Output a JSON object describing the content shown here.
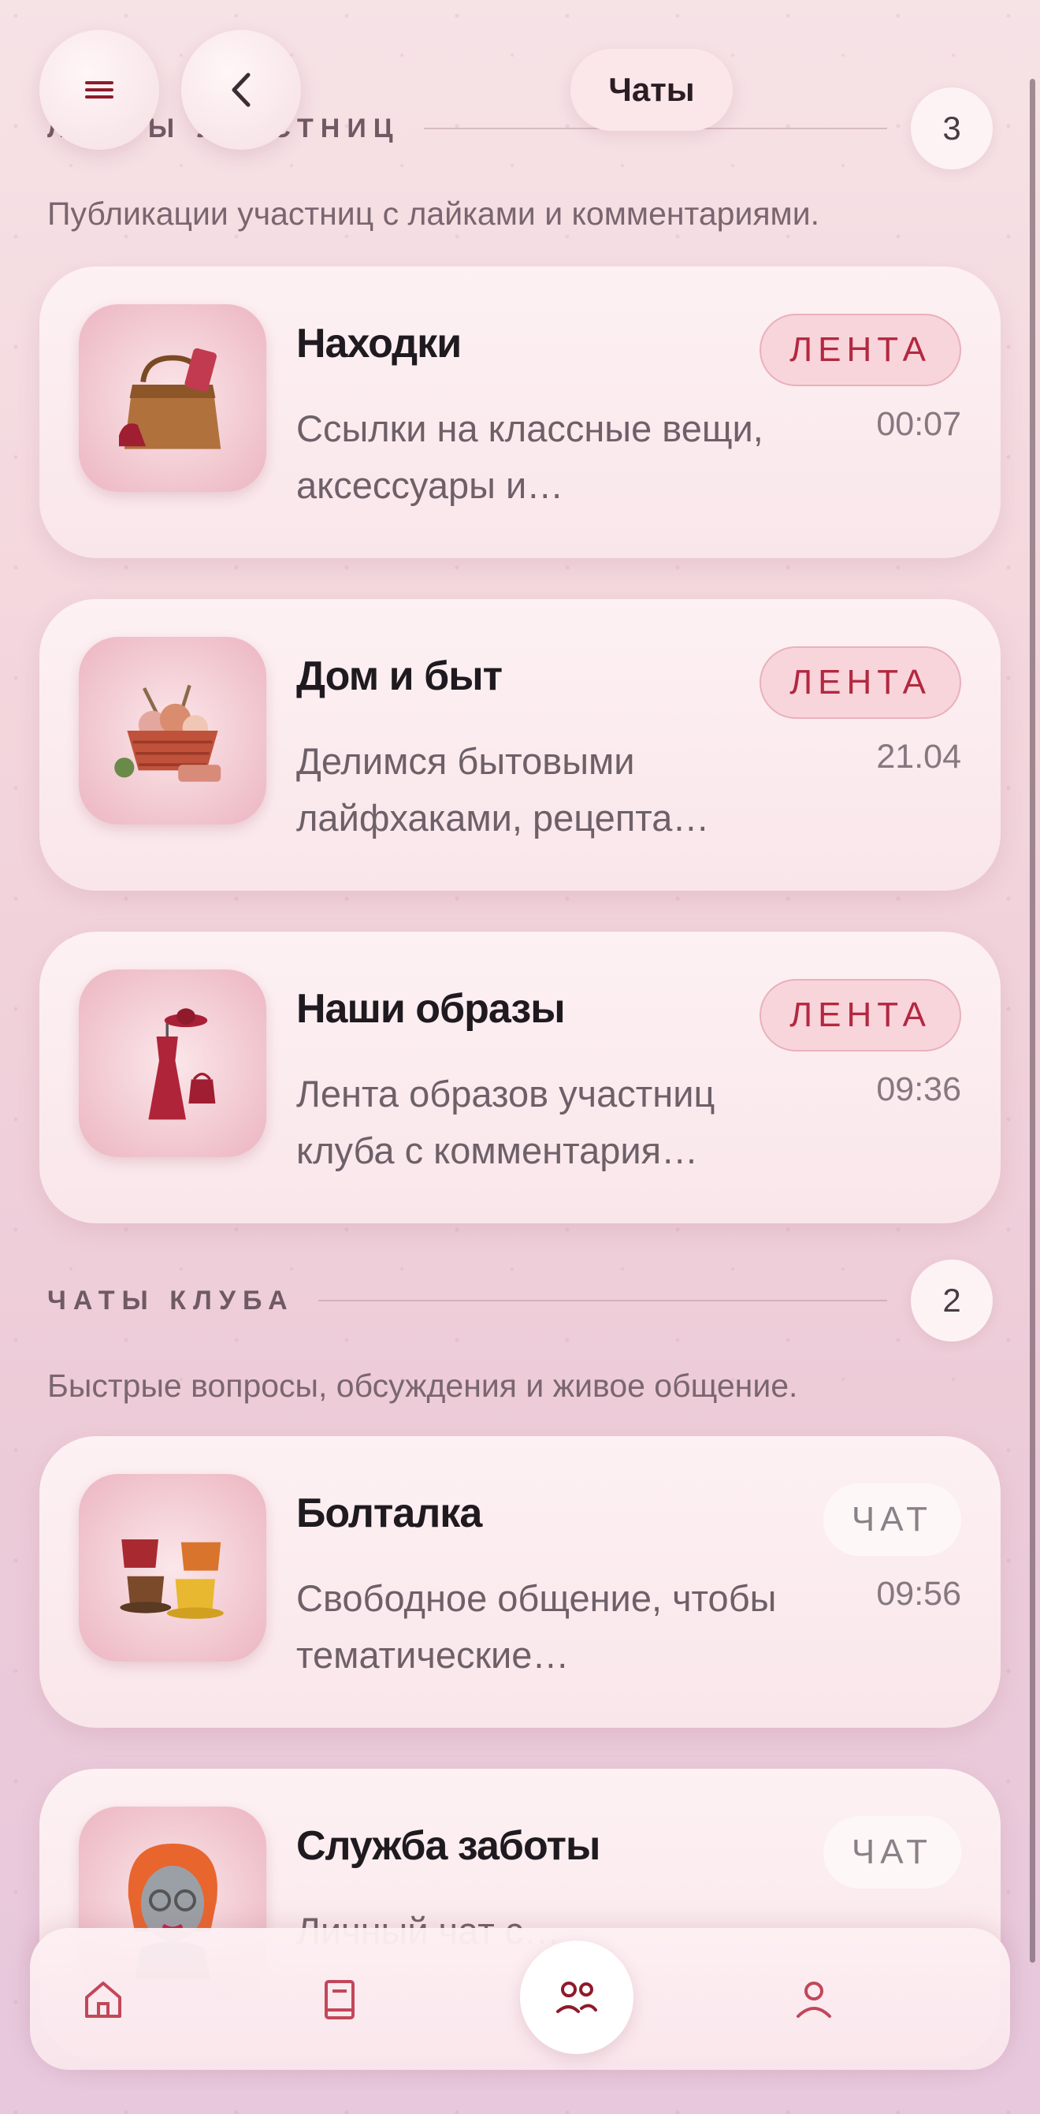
{
  "header": {
    "menu_icon": "hamburger-menu-icon",
    "back_icon": "chevron-left-icon",
    "title": "Чаты"
  },
  "sections": [
    {
      "title": "ЛЕНТЫ УЧАСТНИЦ",
      "count": "3",
      "description": "Публикации участниц с лайками и комментариями.",
      "items": [
        {
          "title": "Находки",
          "description": "Ссылки на классные вещи, аксессуары и…",
          "tag": "ЛЕНТА",
          "time": "00:07",
          "thumb": "handbag-icon"
        },
        {
          "title": "Дом и быт",
          "description": "Делимся бытовыми лайфхаками, рецепта…",
          "tag": "ЛЕНТА",
          "time": "21.04",
          "thumb": "knitting-basket-icon"
        },
        {
          "title": "Наши образы",
          "description": "Лента образов участниц клуба с комментария…",
          "tag": "ЛЕНТА",
          "time": "09:36",
          "thumb": "dress-icon"
        }
      ]
    },
    {
      "title": "ЧАТЫ КЛУБА",
      "count": "2",
      "description": "Быстрые вопросы, обсуждения и живое общение.",
      "items": [
        {
          "title": "Болталка",
          "description": "Свободное общение, чтобы тематические…",
          "tag": "ЧАТ",
          "time": "09:56",
          "thumb": "coffee-cups-icon"
        },
        {
          "title": "Служба заботы",
          "description": "Личный чат с…",
          "tag": "ЧАТ",
          "time": "",
          "thumb": "assistant-avatar-icon"
        }
      ]
    }
  ],
  "bottom_nav": {
    "items": [
      "home-icon",
      "book-icon",
      "community-icon",
      "profile-icon"
    ],
    "active": "community-icon"
  },
  "colors": {
    "accent": "#b32840",
    "feed_tag_bg": "#f8d5db",
    "chat_tag_bg": "#fdf7f8"
  }
}
